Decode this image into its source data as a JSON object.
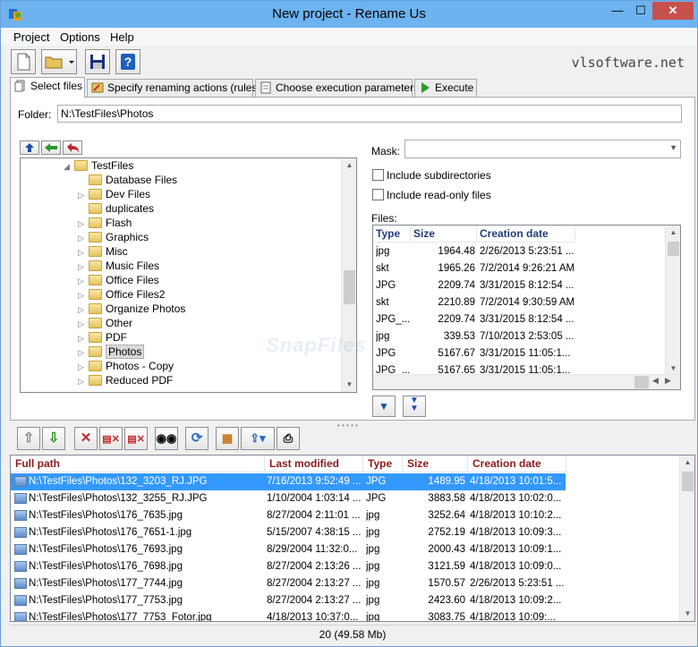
{
  "window": {
    "title": "New project - Rename Us",
    "minimize": "—",
    "maximize": "☐",
    "close": "✕"
  },
  "menu": [
    "Project",
    "Options",
    "Help"
  ],
  "brand": "vlsoftware.net",
  "tabs": [
    {
      "label": "Select files",
      "active": true
    },
    {
      "label": "Specify renaming actions (rules)"
    },
    {
      "label": "Choose execution parameters"
    },
    {
      "label": "Execute"
    }
  ],
  "folder": {
    "label": "Folder:",
    "value": "N:\\TestFiles\\Photos"
  },
  "tree": {
    "root": "TestFiles",
    "items": [
      "Database Files",
      "Dev Files",
      "duplicates",
      "Flash",
      "Graphics",
      "Misc",
      "Music Files",
      "Office Files",
      "Office Files2",
      "Organize Photos",
      "Other",
      "PDF",
      "Photos",
      "Photos - Copy",
      "Reduced PDF"
    ],
    "selected": "Photos"
  },
  "mask": {
    "label": "Mask:",
    "value": ""
  },
  "options": {
    "subdirs": "Include subdirectories",
    "readonly": "Include read-only files"
  },
  "files_label": "Files:",
  "files_table": {
    "headers": [
      "Type",
      "Size",
      "Creation date"
    ],
    "rows": [
      [
        "jpg",
        "1964.48",
        "2/26/2013 5:23:51 ..."
      ],
      [
        "skt",
        "1965.26",
        "7/2/2014 9:26:21 AM"
      ],
      [
        "JPG",
        "2209.74",
        "3/31/2015 8:12:54 ..."
      ],
      [
        "skt",
        "2210.89",
        "7/2/2014 9:30:59 AM"
      ],
      [
        "JPG_...",
        "2209.74",
        "3/31/2015 8:12:54 ..."
      ],
      [
        "jpg",
        "339.53",
        "7/10/2013 2:53:05 ..."
      ],
      [
        "JPG",
        "5167.67",
        "3/31/2015 11:05:1..."
      ],
      [
        "JPG_...",
        "5167.65",
        "3/31/2015 11:05:1..."
      ]
    ]
  },
  "grid": {
    "headers": [
      "Full path",
      "Last modified date",
      "Type",
      "Size",
      "Creation date"
    ],
    "rows": [
      [
        "N:\\TestFiles\\Photos\\132_3203_RJ.JPG",
        "7/16/2013 9:52:49 ...",
        "JPG",
        "1489.95",
        "4/18/2013 10:01:5..."
      ],
      [
        "N:\\TestFiles\\Photos\\132_3255_RJ.JPG",
        "1/10/2004 1:03:14 ...",
        "JPG",
        "3883.58",
        "4/18/2013 10:02:0..."
      ],
      [
        "N:\\TestFiles\\Photos\\176_7635.jpg",
        "8/27/2004 2:11:01 ...",
        "jpg",
        "3252.64",
        "4/18/2013 10:10:2..."
      ],
      [
        "N:\\TestFiles\\Photos\\176_7651-1.jpg",
        "5/15/2007 4:38:15 ...",
        "jpg",
        "2752.19",
        "4/18/2013 10:09:3..."
      ],
      [
        "N:\\TestFiles\\Photos\\176_7693.jpg",
        "8/29/2004 11:32:0...",
        "jpg",
        "2000.43",
        "4/18/2013 10:09:1..."
      ],
      [
        "N:\\TestFiles\\Photos\\176_7698.jpg",
        "8/27/2004 2:13:26 ...",
        "jpg",
        "3121.59",
        "4/18/2013 10:09:0..."
      ],
      [
        "N:\\TestFiles\\Photos\\177_7744.jpg",
        "8/27/2004 2:13:27 ...",
        "jpg",
        "1570.57",
        "2/26/2013 5:23:51 ..."
      ],
      [
        "N:\\TestFiles\\Photos\\177_7753.jpg",
        "8/27/2004 2:13:27 ...",
        "jpg",
        "2423.60",
        "4/18/2013 10:09:2..."
      ],
      [
        "N:\\TestFiles\\Photos\\177_7753_Fotor.jpg",
        "4/18/2013 10:37:0...",
        "jpg",
        "3083.75",
        "4/18/2013 10:09:..."
      ]
    ]
  },
  "status": "20  (49.58 Mb)",
  "watermark": "SnapFiles",
  "colors": {
    "titlebar": "#6cb3f0",
    "selection": "#3399ff",
    "grid_header": "#8b1a1a",
    "table_header": "#1f3d7a"
  }
}
